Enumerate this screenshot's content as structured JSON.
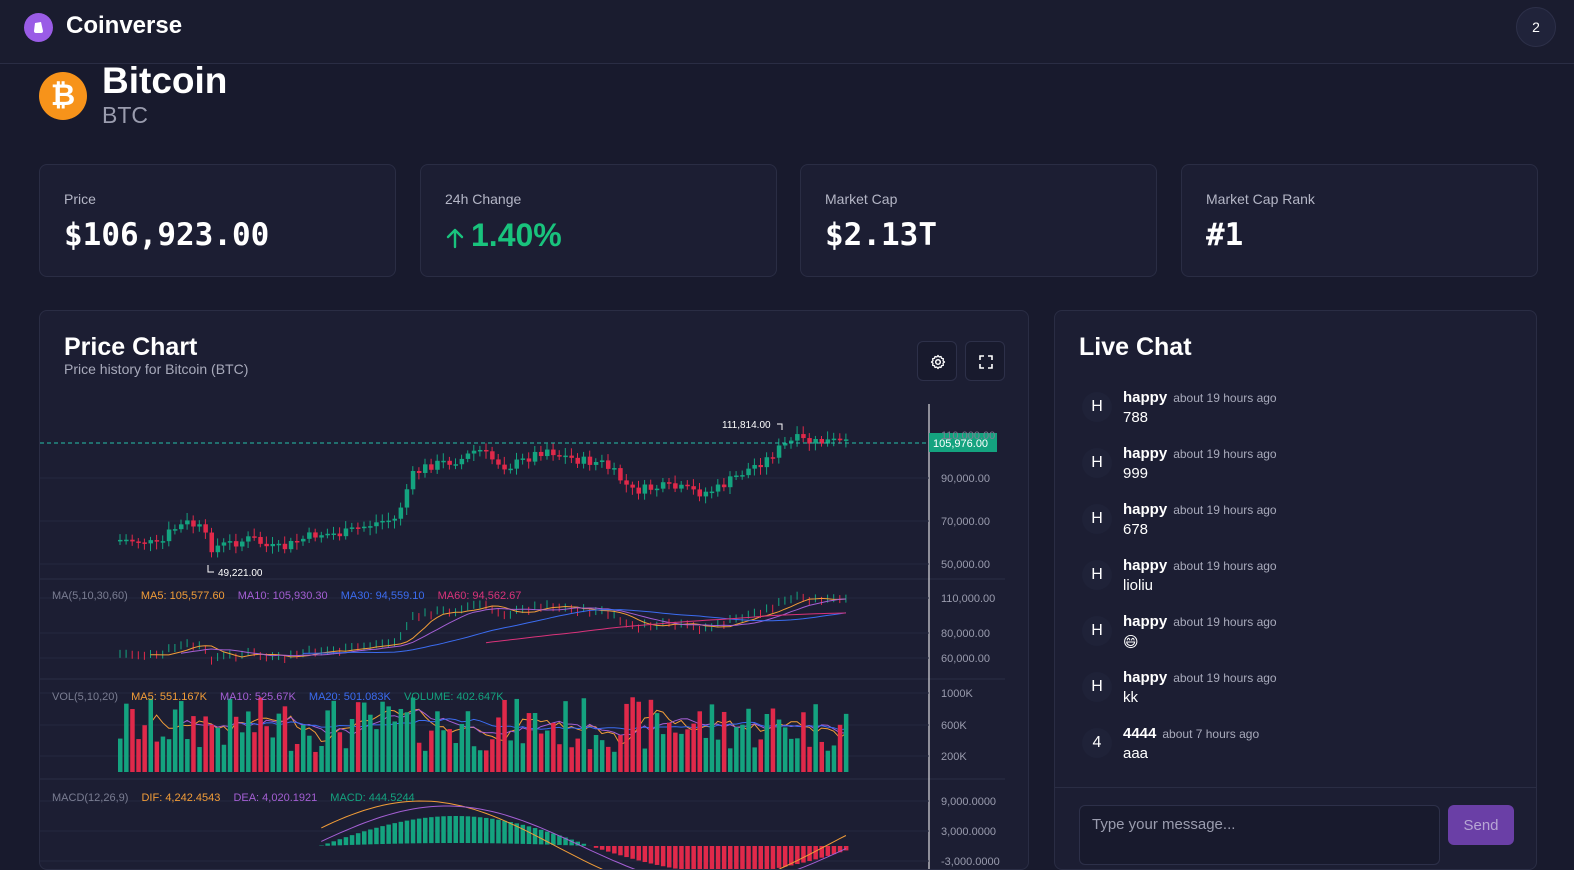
{
  "app": {
    "title": "Coinverse",
    "notification_count": "2"
  },
  "coin": {
    "name": "Bitcoin",
    "symbol": "BTC",
    "logo_glyph": "₿"
  },
  "stats": [
    {
      "label": "Price",
      "value": "$106,923.00"
    },
    {
      "label": "24h Change",
      "value": "1.40%"
    },
    {
      "label": "Market Cap",
      "value": "$2.13T"
    },
    {
      "label": "Market Cap Rank",
      "value": "#1"
    }
  ],
  "chart": {
    "title": "Price Chart",
    "subtitle": "Price history for Bitcoin (BTC)",
    "last_price_label": "105,976.00",
    "high_label": "111,814.00",
    "low_label": "49,221.00",
    "price_axis": [
      "110,000.00",
      "90,000.00",
      "70,000.00",
      "50,000.00"
    ],
    "ma_legend": {
      "label": "MA(5,10,30,60)",
      "ma5": "MA5: 105,577.60",
      "ma10": "MA10: 105,930.30",
      "ma30": "MA30: 94,559.10",
      "ma60": "MA60: 94,562.67"
    },
    "ma_axis": [
      "110,000.00",
      "80,000.00",
      "60,000.00"
    ],
    "vol_legend": {
      "label": "VOL(5,10,20)",
      "ma5": "MA5: 551.167K",
      "ma10": "MA10: 525.67K",
      "ma20": "MA20: 501.083K",
      "volume": "VOLUME: 402.647K"
    },
    "vol_axis": [
      "1000K",
      "600K",
      "200K"
    ],
    "macd_legend": {
      "label": "MACD(12,26,9)",
      "dif": "DIF: 4,242.4543",
      "dea": "DEA: 4,020.1921",
      "macd": "MACD: 444.5244"
    },
    "macd_axis": [
      "9,000.0000",
      "3,000.0000",
      "-3,000.0000"
    ],
    "colors": {
      "up": "#14a37f",
      "down": "#e0294a",
      "ma5": "#f29d38",
      "ma10": "#a45fd4",
      "ma30": "#3b6cf0",
      "ma60": "#d9337a"
    }
  },
  "chat": {
    "title": "Live Chat",
    "messages": [
      {
        "avatar": "H",
        "user": "happy",
        "time": "about 19 hours ago",
        "text": "788"
      },
      {
        "avatar": "H",
        "user": "happy",
        "time": "about 19 hours ago",
        "text": "999"
      },
      {
        "avatar": "H",
        "user": "happy",
        "time": "about 19 hours ago",
        "text": "678"
      },
      {
        "avatar": "H",
        "user": "happy",
        "time": "about 19 hours ago",
        "text": "lioliu"
      },
      {
        "avatar": "H",
        "user": "happy",
        "time": "about 19 hours ago",
        "text": "😄"
      },
      {
        "avatar": "H",
        "user": "happy",
        "time": "about 19 hours ago",
        "text": "kk"
      },
      {
        "avatar": "4",
        "user": "4444",
        "time": "about 7 hours ago",
        "text": "aaa"
      }
    ],
    "input_placeholder": "Type your message...",
    "send_label": "Send"
  }
}
